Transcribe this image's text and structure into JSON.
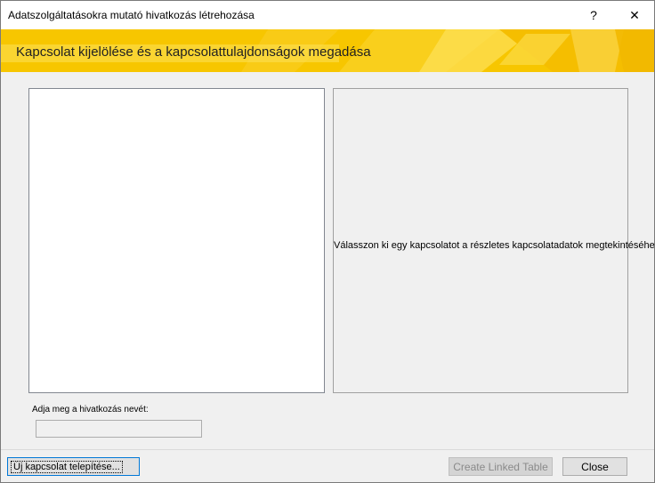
{
  "window": {
    "title": "Adatszolgáltatásokra mutató hivatkozás létrehozása",
    "help_label": "?",
    "close_label": "✕"
  },
  "banner": {
    "title": "Kapcsolat kijelölése és a kapcsolattulajdonságok megadása",
    "colors": {
      "base": "#f7c600",
      "light": "#fde15a",
      "dark": "#f0b400"
    }
  },
  "detail": {
    "message": "Válasszon ki egy kapcsolatot a részletes kapcsolatadatok megtekintéséhez."
  },
  "link_name": {
    "label": "Adja meg a hivatkozás nevét:",
    "value": ""
  },
  "buttons": {
    "new_connection": "Új kapcsolat telepítése...",
    "create_linked_table": "Create Linked Table",
    "close": "Close"
  }
}
